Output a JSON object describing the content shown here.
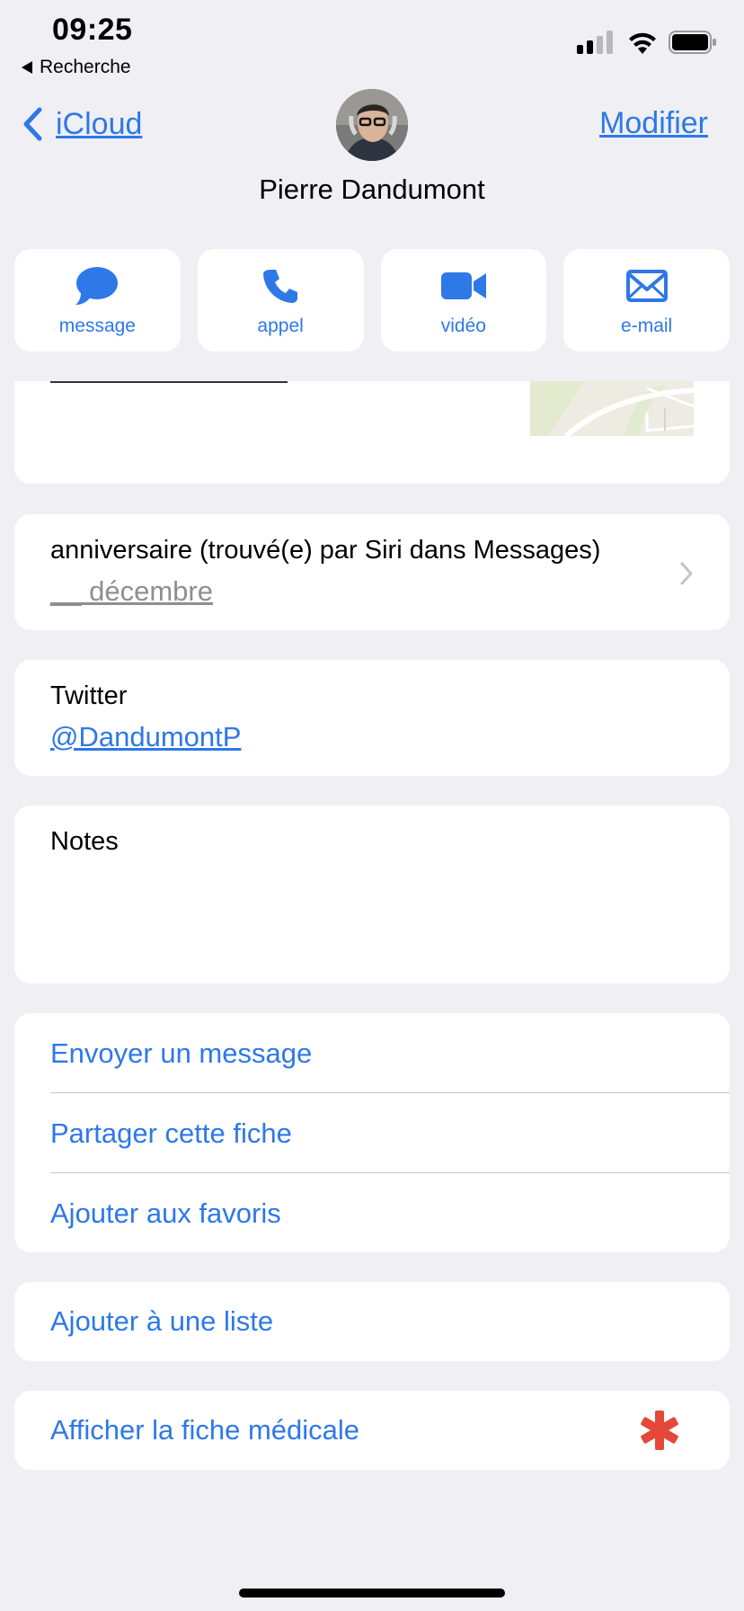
{
  "status_bar": {
    "time": "09:25",
    "back_app": "Recherche"
  },
  "nav": {
    "back_label": "iCloud",
    "edit_label": "Modifier"
  },
  "contact": {
    "name": "Pierre Dandumont"
  },
  "actions": [
    {
      "label": "message",
      "icon": "speech-bubble-icon"
    },
    {
      "label": "appel",
      "icon": "phone-icon"
    },
    {
      "label": "vidéo",
      "icon": "video-camera-icon"
    },
    {
      "label": "e-mail",
      "icon": "envelope-icon"
    }
  ],
  "birthday": {
    "label": "anniversaire (trouvé(e) par Siri dans Messages)",
    "value": "__ décembre"
  },
  "twitter": {
    "label": "Twitter",
    "handle": "@DandumontP"
  },
  "notes": {
    "label": "Notes"
  },
  "links": {
    "send_message": "Envoyer un message",
    "share": "Partager cette fiche",
    "favorites": "Ajouter aux favoris",
    "add_list": "Ajouter à une liste",
    "medical": "Afficher la fiche médicale"
  },
  "colors": {
    "accent": "#2E78E8",
    "background": "#EFEFF4",
    "medical": "#E5473A"
  }
}
